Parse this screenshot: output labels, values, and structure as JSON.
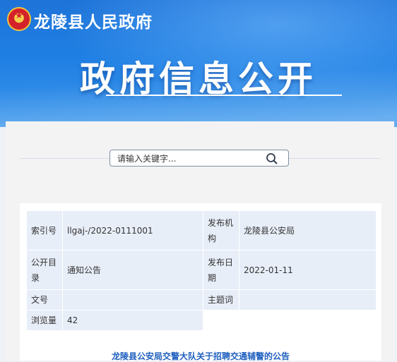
{
  "header": {
    "site_title": "龙陵县人民政府",
    "banner_title": "政府信息公开",
    "brand_color": "#1f7fe3"
  },
  "search": {
    "placeholder": "请输入关键字...",
    "icon": "search-icon"
  },
  "meta": {
    "index_label": "索引号",
    "index_value": "llgaj-/2022-0111001",
    "publisher_label": "发布机构",
    "publisher_value": "龙陵县公安局",
    "catalog_label": "公开目录",
    "catalog_value": "通知公告",
    "date_label": "发布日期",
    "date_value": "2022-01-11",
    "docno_label": "文号",
    "docno_value": "",
    "subject_label": "主题词",
    "subject_value": "",
    "views_label": "浏览量",
    "views_value": "42"
  },
  "article": {
    "title": "龙陵县公安局交警大队关于招聘交通辅警的公告"
  }
}
